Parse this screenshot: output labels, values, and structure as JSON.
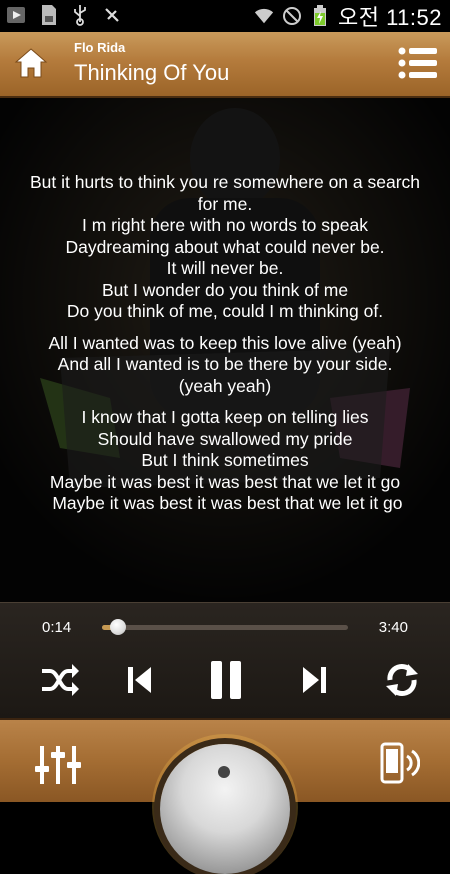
{
  "status_bar": {
    "clock": "오전 11:52",
    "icons": [
      "media-player-icon",
      "sd-card-icon",
      "usb-icon",
      "usb-debug-icon",
      "wifi-icon",
      "no-signal-icon",
      "battery-charging-icon"
    ]
  },
  "header": {
    "artist": "Flo Rida",
    "song_title": "Thinking Of You"
  },
  "lyrics": [
    "But it hurts to think you re somewhere on a search",
    "for me.",
    "I m right here with no words to speak",
    "Daydreaming about what could never be.",
    "It will never be.",
    "But I wonder do you think of me",
    "Do you think of me, could I m thinking of.",
    "",
    "All I wanted was to keep this love alive (yeah)",
    "And all I wanted is to be there by your side.",
    "(yeah yeah)",
    "",
    "I know that I gotta keep on telling lies",
    "Should have swallowed my pride",
    "But I think sometimes",
    "Maybe it was best it was best that we let it go",
    " Maybe it was best it was best that we let it go"
  ],
  "player": {
    "current_time": "0:14",
    "total_time": "3:40",
    "progress_fraction": 0.064
  },
  "colors": {
    "wood": "#b47b3c",
    "accent": "#c79a53"
  }
}
